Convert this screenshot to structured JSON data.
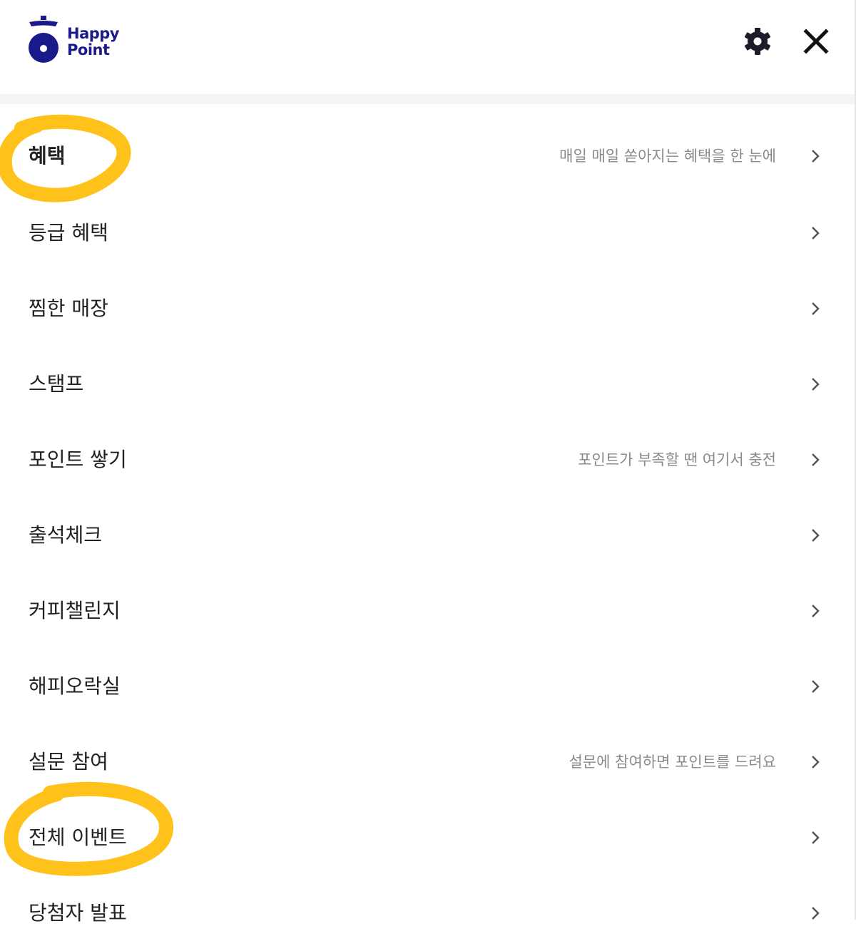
{
  "app": {
    "logo_line1": "Happy",
    "logo_line2": "Point",
    "brand_color": "#1b1a8a"
  },
  "header": {
    "settings_icon": "gear-icon",
    "close_icon": "close-icon"
  },
  "menu": [
    {
      "label": "혜택",
      "hint": "매일 매일 쏟아지는 혜택을 한 눈에"
    },
    {
      "label": "등급 혜택",
      "hint": ""
    },
    {
      "label": "찜한 매장",
      "hint": ""
    },
    {
      "label": "스탬프",
      "hint": ""
    },
    {
      "label": "포인트 쌓기",
      "hint": "포인트가 부족할 땐 여기서 충전"
    },
    {
      "label": "출석체크",
      "hint": ""
    },
    {
      "label": "커피챌린지",
      "hint": ""
    },
    {
      "label": "해피오락실",
      "hint": ""
    },
    {
      "label": "설문 참여",
      "hint": "설문에 참여하면 포인트를 드려요"
    },
    {
      "label": "전체 이벤트",
      "hint": ""
    },
    {
      "label": "당첨자 발표",
      "hint": ""
    }
  ],
  "annotation_color": "#ffc21a"
}
